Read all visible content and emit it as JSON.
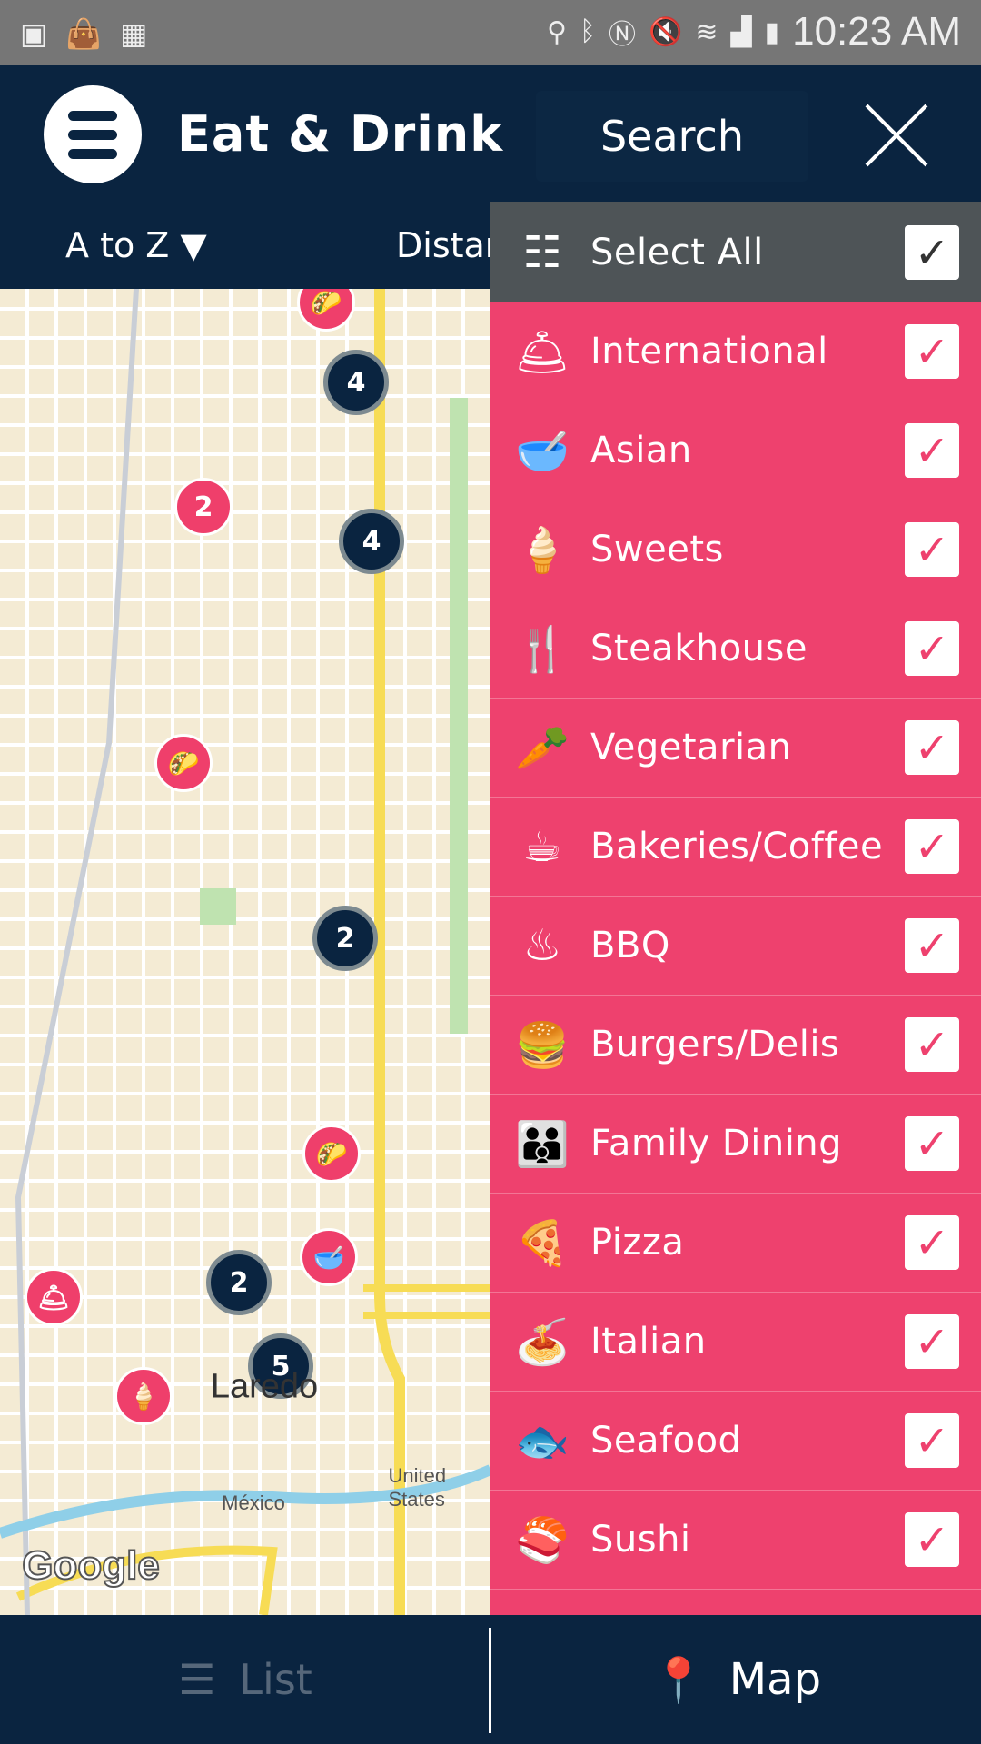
{
  "status_bar": {
    "time": "10:23 AM",
    "left_icons": [
      "image-icon",
      "shopping-bag-icon",
      "sim-icon"
    ],
    "right_icons": [
      "location-icon",
      "bluetooth-icon",
      "nfc-icon",
      "mute-icon",
      "wifi-icon",
      "signal-icon",
      "battery-icon"
    ]
  },
  "header": {
    "title": "Eat & Drink",
    "search_label": "Search",
    "sort_label": "A to Z",
    "sort_arrow": "▼",
    "distance_label": "Distar"
  },
  "map": {
    "markers": [
      {
        "type": "category",
        "icon": "taco"
      },
      {
        "type": "cluster",
        "count": "4"
      },
      {
        "type": "category-count",
        "count": "2"
      },
      {
        "type": "cluster",
        "count": "4"
      },
      {
        "type": "category",
        "icon": "taco"
      },
      {
        "type": "cluster",
        "count": "2"
      },
      {
        "type": "category",
        "icon": "taco"
      },
      {
        "type": "category",
        "icon": "bowl"
      },
      {
        "type": "cluster",
        "count": "2"
      },
      {
        "type": "category",
        "icon": "cloche"
      },
      {
        "type": "cluster",
        "count": "5"
      },
      {
        "type": "category",
        "icon": "ice-cream"
      }
    ],
    "labels": {
      "city": "Laredo",
      "mexico": "México",
      "us": "United States",
      "google": "Google"
    }
  },
  "filter": {
    "select_all": {
      "label": "Select All",
      "checked": true
    },
    "categories": [
      {
        "label": "International",
        "icon": "🛎",
        "checked": true
      },
      {
        "label": "Asian",
        "icon": "🥣",
        "checked": true
      },
      {
        "label": "Sweets",
        "icon": "🍦",
        "checked": true
      },
      {
        "label": "Steakhouse",
        "icon": "🍴",
        "checked": true
      },
      {
        "label": "Vegetarian",
        "icon": "🥕",
        "checked": true
      },
      {
        "label": "Bakeries/Coffee",
        "icon": "☕",
        "checked": true
      },
      {
        "label": "BBQ",
        "icon": "♨",
        "checked": true
      },
      {
        "label": "Burgers/Delis",
        "icon": "🍔",
        "checked": true
      },
      {
        "label": "Family Dining",
        "icon": "👪",
        "checked": true
      },
      {
        "label": "Pizza",
        "icon": "🍕",
        "checked": true
      },
      {
        "label": "Italian",
        "icon": "🍝",
        "checked": true
      },
      {
        "label": "Seafood",
        "icon": "🐟",
        "checked": true
      },
      {
        "label": "Sushi",
        "icon": "🍣",
        "checked": true
      }
    ],
    "check_glyph": "✓"
  },
  "bottom_nav": {
    "list_label": "List",
    "map_label": "Map",
    "active": "Map"
  },
  "colors": {
    "navy": "#0a2440",
    "pink": "#ee416e",
    "gray": "#4e5457"
  }
}
